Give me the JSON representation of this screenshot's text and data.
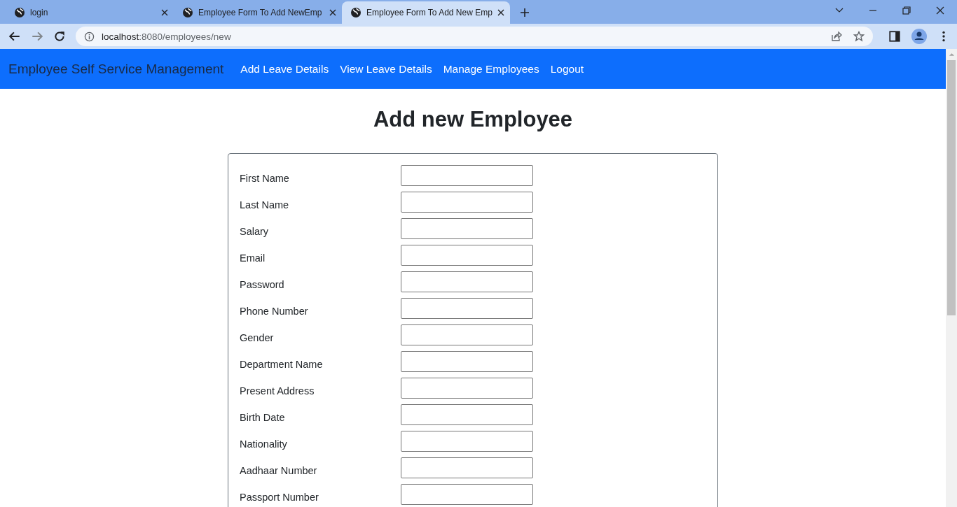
{
  "browser": {
    "tabs": [
      {
        "title": "login",
        "selected": false
      },
      {
        "title": "Employee Form To Add NewEmp",
        "selected": false
      },
      {
        "title": "Employee Form To Add New Emp",
        "selected": true
      }
    ],
    "address": {
      "host": "localhost",
      "path": ":8080/employees/new"
    }
  },
  "navbar": {
    "brand": "Employee Self Service Management",
    "links": [
      "Add Leave Details",
      "View Leave Details",
      "Manage Employees",
      "Logout"
    ]
  },
  "heading": "Add new Employee",
  "form": {
    "fields": [
      {
        "label": "First Name"
      },
      {
        "label": "Last Name"
      },
      {
        "label": "Salary"
      },
      {
        "label": "Email"
      },
      {
        "label": "Password"
      },
      {
        "label": "Phone Number"
      },
      {
        "label": "Gender"
      },
      {
        "label": "Department Name"
      },
      {
        "label": "Present Address"
      },
      {
        "label": "Birth Date"
      },
      {
        "label": "Nationality"
      },
      {
        "label": "Aadhaar Number"
      },
      {
        "label": "Passport Number"
      }
    ]
  }
}
